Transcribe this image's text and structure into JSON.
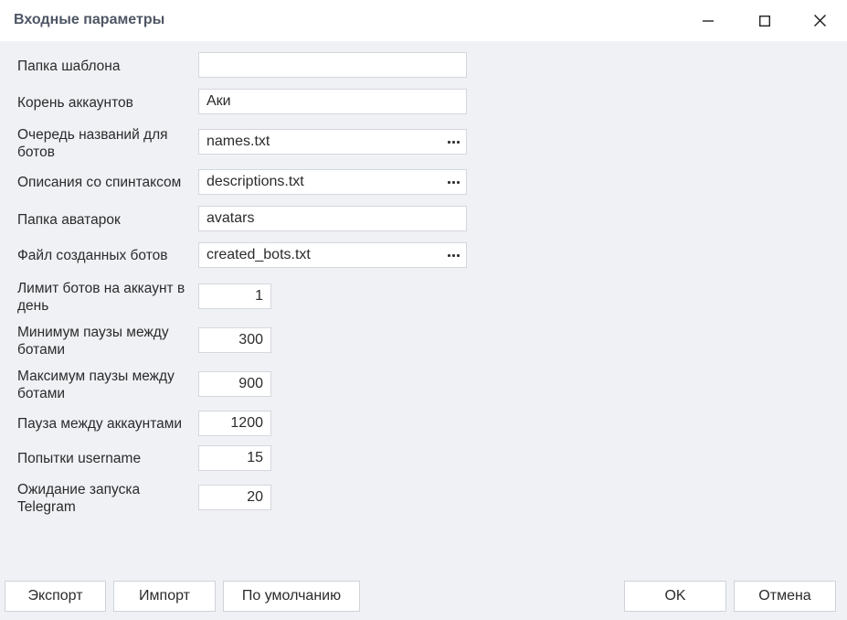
{
  "window": {
    "title": "Входные параметры"
  },
  "fields": [
    {
      "label": "Папка шаблона",
      "value": "",
      "type": "text",
      "browse": false
    },
    {
      "label": "Корень аккаунтов",
      "value": "Аки",
      "type": "text",
      "browse": false
    },
    {
      "label": "Очередь названий для ботов",
      "value": "names.txt",
      "type": "file",
      "browse": true
    },
    {
      "label": "Описания со спинтаксом",
      "value": "descriptions.txt",
      "type": "file",
      "browse": true
    },
    {
      "label": "Папка аватарок",
      "value": "avatars",
      "type": "text",
      "browse": false
    },
    {
      "label": "Файл созданных ботов",
      "value": "created_bots.txt",
      "type": "file",
      "browse": true
    },
    {
      "label": "Лимит ботов на аккаунт в день",
      "value": "1",
      "type": "number",
      "browse": false
    },
    {
      "label": "Минимум паузы между ботами",
      "value": "300",
      "type": "number",
      "browse": false
    },
    {
      "label": "Максимум паузы между ботами",
      "value": "900",
      "type": "number",
      "browse": false
    },
    {
      "label": "Пауза между аккаунтами",
      "value": "1200",
      "type": "number",
      "browse": false
    },
    {
      "label": "Попытки username",
      "value": "15",
      "type": "number",
      "browse": false
    },
    {
      "label": "Ожидание запуска Telegram",
      "value": "20",
      "type": "number",
      "browse": false
    }
  ],
  "buttons": {
    "export": "Экспорт",
    "import": "Импорт",
    "defaults": "По умолчанию",
    "ok": "OK",
    "cancel": "Отмена"
  },
  "icons": {
    "minimize": "minimize-icon",
    "maximize": "maximize-icon",
    "close": "close-icon",
    "browse": "ellipsis-icon"
  }
}
